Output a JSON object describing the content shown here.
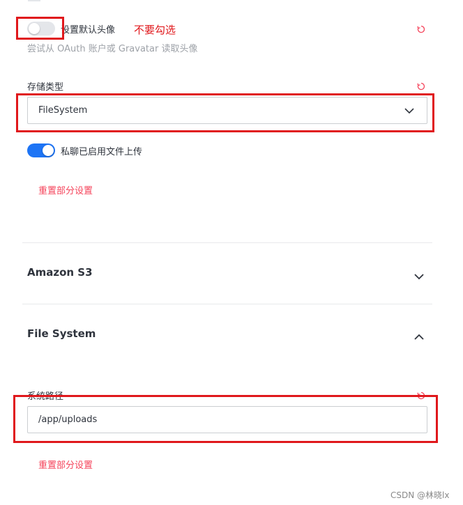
{
  "avatar_setting": {
    "label": "设置默认头像",
    "hint": "尝试从 OAuth 账户或 Gravatar 读取头像",
    "enabled": false
  },
  "annotation": {
    "text": "不要勾选"
  },
  "storage_type": {
    "label": "存储类型",
    "value": "FileSystem"
  },
  "dm_upload": {
    "label": "私聊已启用文件上传",
    "enabled": true
  },
  "reset_section": {
    "label": "重置部分设置"
  },
  "sections": {
    "amazon_s3": {
      "title": "Amazon S3",
      "expanded": false
    },
    "file_system": {
      "title": "File System",
      "expanded": true
    }
  },
  "system_path": {
    "label": "系统路径",
    "value": "/app/uploads"
  },
  "reset_section_2": {
    "label": "重置部分设置"
  },
  "colors": {
    "toggle_on": "#1d74f5",
    "reset_red": "#f5455c",
    "annotation_red": "#e0181c"
  },
  "watermark": {
    "text": "CSDN @林晓lx"
  }
}
